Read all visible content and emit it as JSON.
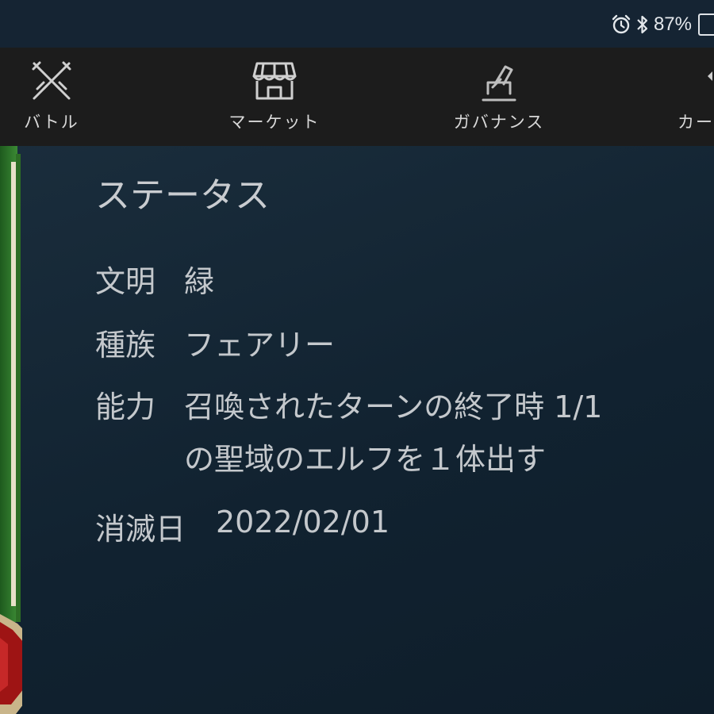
{
  "status_bar": {
    "battery_percent": "87%",
    "icons": [
      "alarm-icon",
      "bluetooth-icon",
      "battery-icon"
    ]
  },
  "nav": {
    "items": [
      {
        "label": "バトル",
        "icon": "crossed-swords-icon"
      },
      {
        "label": "マーケット",
        "icon": "storefront-icon"
      },
      {
        "label": "ガバナンス",
        "icon": "ballot-vote-icon"
      },
      {
        "label": "カー",
        "icon": "cards-icon"
      }
    ]
  },
  "status_section": {
    "title": "ステータス",
    "civilization": {
      "key": "文明",
      "value": "緑"
    },
    "race": {
      "key": "種族",
      "value": "フェアリー"
    },
    "ability": {
      "key": "能力",
      "line1": "召喚されたターンの終了時 1/1",
      "line2": "の聖域のエルフを１体出す"
    },
    "expiry": {
      "key": "消滅日",
      "value": "2022/02/01"
    }
  },
  "colors": {
    "status_bar_bg": "#152433",
    "nav_bg": "#1c1c1c",
    "content_bg": "#142230",
    "text": "#c4c8cc",
    "card_green": "#2f7a2a",
    "card_red": "#a01a1a"
  }
}
